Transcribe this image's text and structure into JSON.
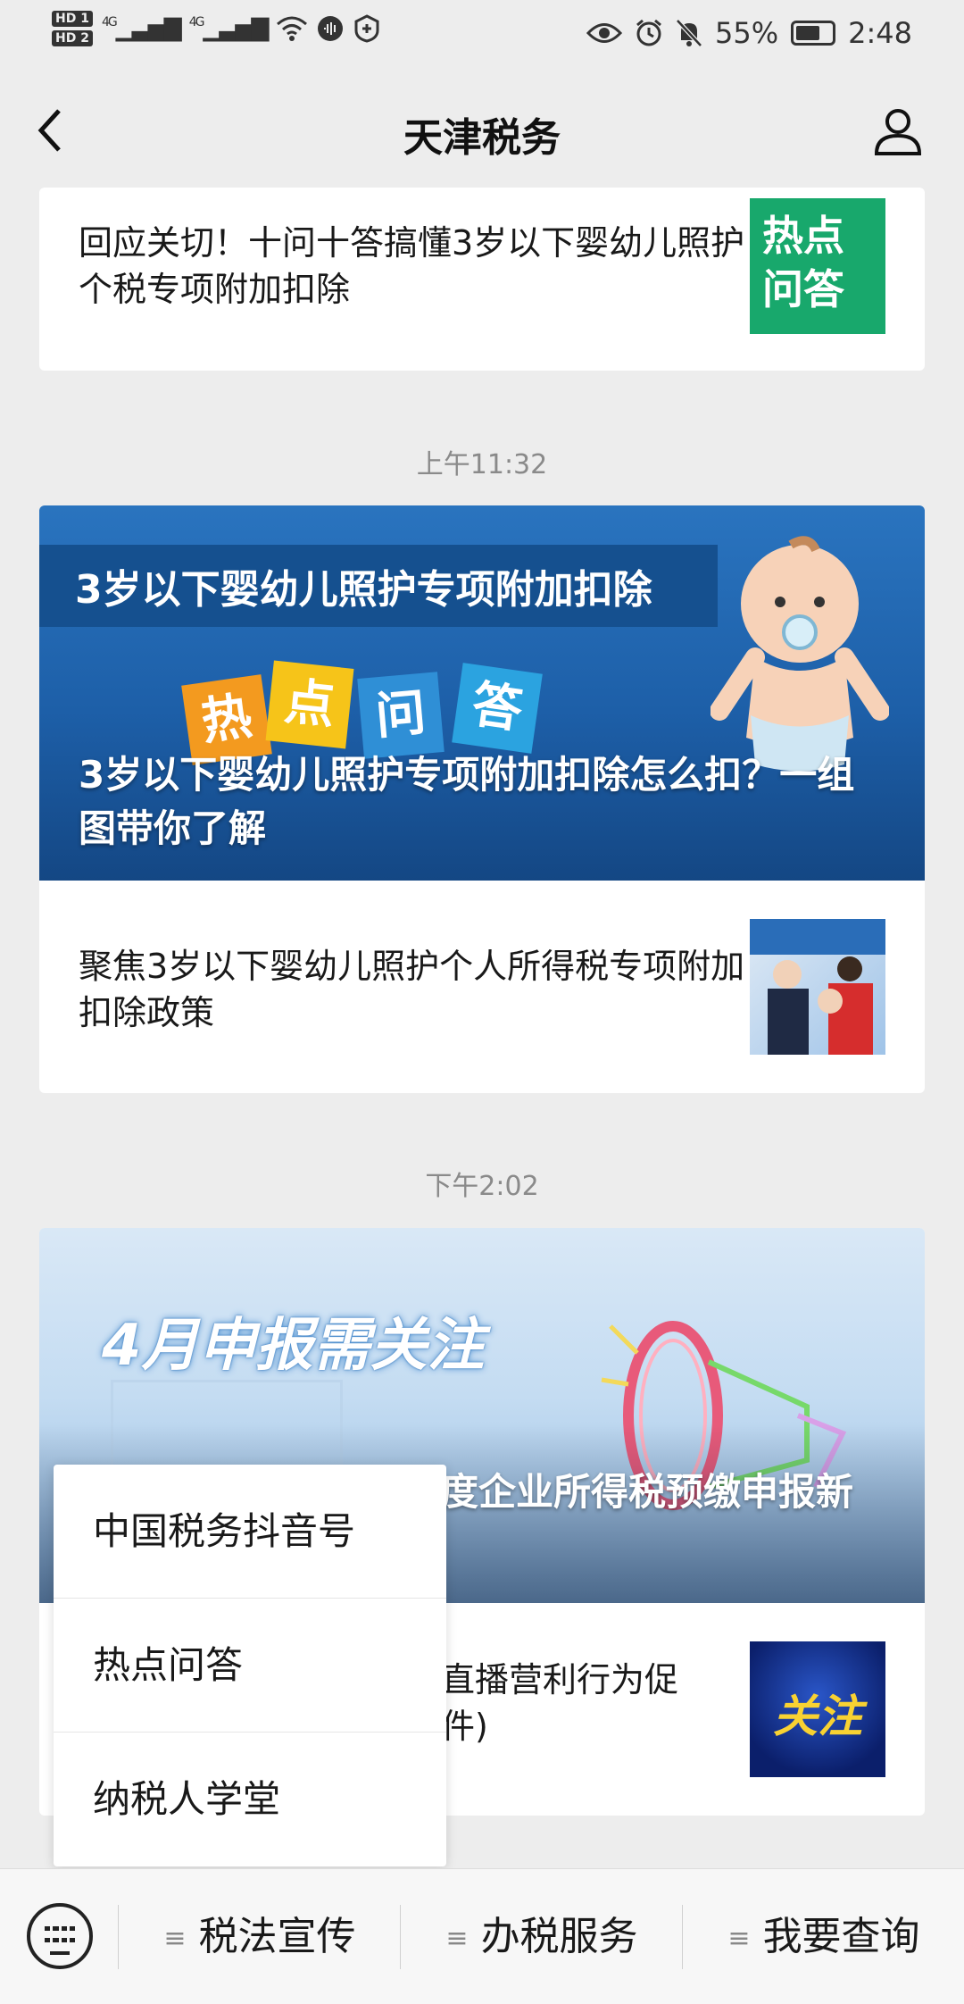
{
  "status": {
    "hd1": "HD 1",
    "hd2": "HD 2",
    "signal1": "4G",
    "signal2": "4G",
    "battery_pct": "55%",
    "time": "2:48"
  },
  "nav": {
    "title": "天津税务"
  },
  "articles": {
    "first": {
      "text": "回应关切！十问十答搞懂3岁以下婴幼儿照护个税专项附加扣除",
      "thumb_text1": "热点",
      "thumb_text2": "问答"
    },
    "time1": "上午11:32",
    "group1": {
      "banner_heading": "3岁以下婴幼儿照护专项附加扣除",
      "banner_tags": [
        "热",
        "点",
        "问",
        "答"
      ],
      "banner_title": "3岁以下婴幼儿照护专项附加扣除怎么扣？一组图带你了解",
      "sub_text": "聚焦3岁以下婴幼儿照护个人所得税专项附加扣除政策"
    },
    "time2": "下午2:02",
    "group2": {
      "banner_heading": "4月申报需关注",
      "banner_title_visible": "度企业所得税预缴申报新",
      "sub_text_visible": "直播营利行为促",
      "sub_text_visible2": "件)",
      "thumb_text": "关注"
    }
  },
  "popup": {
    "items": [
      "中国税务抖音号",
      "热点问答",
      "纳税人学堂"
    ]
  },
  "bottom_menu": {
    "items": [
      "税法宣传",
      "办税服务",
      "我要查询"
    ]
  },
  "colors": {
    "background": "#ededed",
    "thumb_green": "#1aa86c",
    "banner_blue": "#1d5fa8",
    "thumb_navy": "#0b1f6b"
  }
}
